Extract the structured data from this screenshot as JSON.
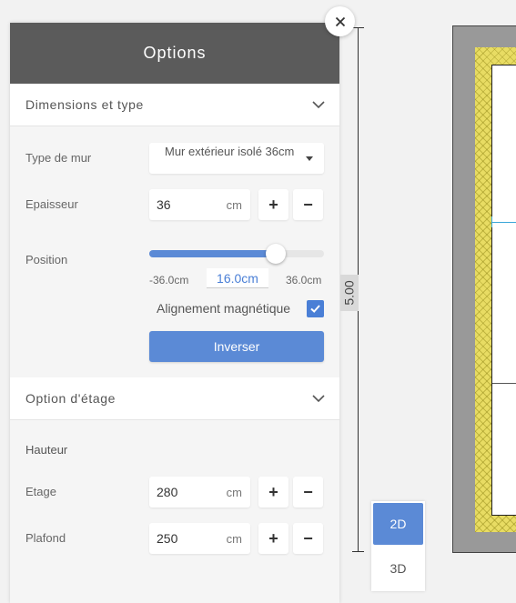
{
  "panel": {
    "title": "Options",
    "section_dimensions": {
      "title": "Dimensions et type",
      "wall_type_label": "Type de mur",
      "wall_type_value": "Mur extérieur isolé 36cm",
      "thickness_label": "Epaisseur",
      "thickness_value": "36",
      "thickness_unit": "cm",
      "position_label": "Position",
      "position_min": "-36.0cm",
      "position_value": "16.0cm",
      "position_max": "36.0cm",
      "position_fraction": 0.722,
      "magnetic_label": "Alignement magnétique",
      "magnetic_checked": true,
      "invert_label": "Inverser"
    },
    "section_floor": {
      "title": "Option d'étage",
      "height_heading": "Hauteur",
      "floor_label": "Etage",
      "floor_value": "280",
      "floor_unit": "cm",
      "ceiling_label": "Plafond",
      "ceiling_value": "250",
      "ceiling_unit": "cm"
    },
    "plus_label": "+",
    "minus_label": "−"
  },
  "canvas": {
    "dimension_label": "5.00",
    "view_2d": "2D",
    "view_3d": "3D"
  },
  "colors": {
    "accent": "#5b8ad6",
    "header": "#5b5b5b",
    "insulation": "#e8dc63",
    "measure_line": "#3aa6d8"
  }
}
